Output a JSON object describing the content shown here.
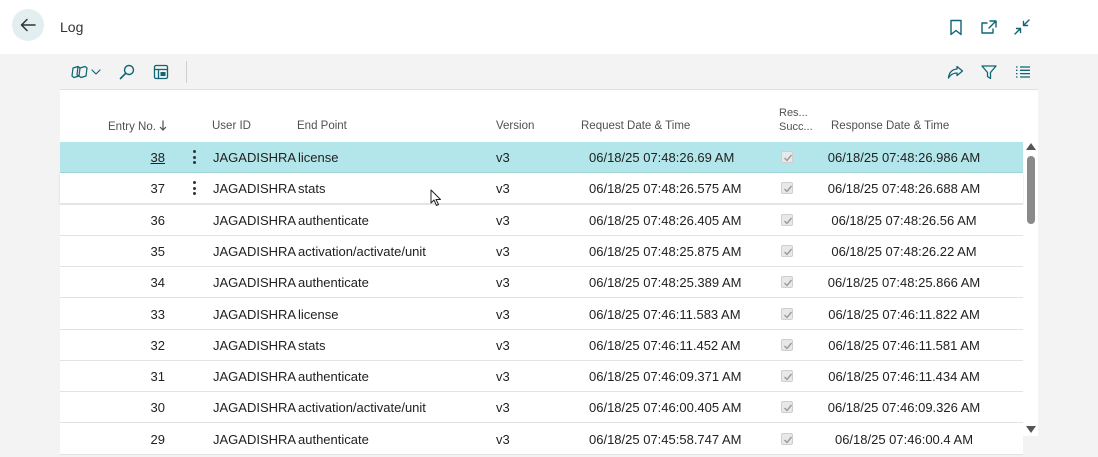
{
  "header": {
    "title": "Log",
    "back_icon": "arrow-left-icon",
    "icons": [
      "bookmark-icon",
      "open-in-new-window-icon",
      "collapse-icon"
    ]
  },
  "toolbar": {
    "icons": [
      "copilot-analyze-icon",
      "search-icon",
      "edit-list-icon",
      "share-icon",
      "filter-icon",
      "list-view-icon"
    ]
  },
  "columns": {
    "entry_no": "Entry No.",
    "user_id": "User ID",
    "end_point": "End Point",
    "version": "Version",
    "request_dt": "Request Date & Time",
    "response_success_1": "Res...",
    "response_success_2": "Succ...",
    "response_dt": "Response Date & Time"
  },
  "rows": [
    {
      "entry": "38",
      "user": "JAGADISHRA",
      "endpoint": "license",
      "version": "v3",
      "request": "06/18/25 07:48:26.69 AM",
      "response": "06/18/25 07:48:26.986 AM",
      "success": true
    },
    {
      "entry": "37",
      "user": "JAGADISHRA",
      "endpoint": "stats",
      "version": "v3",
      "request": "06/18/25 07:48:26.575 AM",
      "response": "06/18/25 07:48:26.688 AM",
      "success": true
    },
    {
      "entry": "36",
      "user": "JAGADISHRA",
      "endpoint": "authenticate",
      "version": "v3",
      "request": "06/18/25 07:48:26.405 AM",
      "response": "06/18/25 07:48:26.56 AM",
      "success": true
    },
    {
      "entry": "35",
      "user": "JAGADISHRA",
      "endpoint": "activation/activate/unit",
      "version": "v3",
      "request": "06/18/25 07:48:25.875 AM",
      "response": "06/18/25 07:48:26.22 AM",
      "success": true
    },
    {
      "entry": "34",
      "user": "JAGADISHRA",
      "endpoint": "authenticate",
      "version": "v3",
      "request": "06/18/25 07:48:25.389 AM",
      "response": "06/18/25 07:48:25.866 AM",
      "success": true
    },
    {
      "entry": "33",
      "user": "JAGADISHRA",
      "endpoint": "license",
      "version": "v3",
      "request": "06/18/25 07:46:11.583 AM",
      "response": "06/18/25 07:46:11.822 AM",
      "success": true
    },
    {
      "entry": "32",
      "user": "JAGADISHRA",
      "endpoint": "stats",
      "version": "v3",
      "request": "06/18/25 07:46:11.452 AM",
      "response": "06/18/25 07:46:11.581 AM",
      "success": true
    },
    {
      "entry": "31",
      "user": "JAGADISHRA",
      "endpoint": "authenticate",
      "version": "v3",
      "request": "06/18/25 07:46:09.371 AM",
      "response": "06/18/25 07:46:11.434 AM",
      "success": true
    },
    {
      "entry": "30",
      "user": "JAGADISHRA",
      "endpoint": "activation/activate/unit",
      "version": "v3",
      "request": "06/18/25 07:46:00.405 AM",
      "response": "06/18/25 07:46:09.326 AM",
      "success": true
    },
    {
      "entry": "29",
      "user": "JAGADISHRA",
      "endpoint": "authenticate",
      "version": "v3",
      "request": "06/18/25 07:45:58.747 AM",
      "response": "06/18/25 07:46:00.4 AM",
      "success": true
    }
  ],
  "colors": {
    "selected_row": "#b2e6ea",
    "back_button_bg": "#e3eef0",
    "accent_icon": "#0e6574"
  }
}
